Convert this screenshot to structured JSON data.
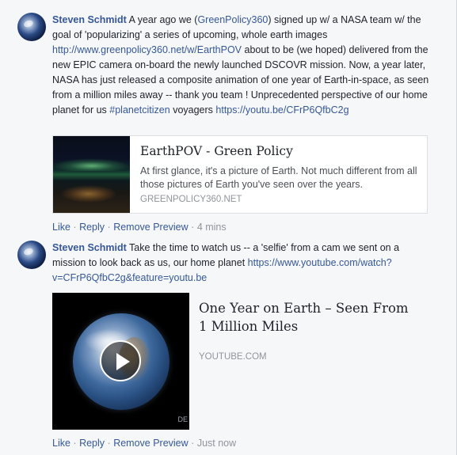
{
  "comments": [
    {
      "author": "Steven Schmidt",
      "body_parts": [
        "A year ago we (",
        "GreenPolicy360",
        ") signed up w/ a NASA team w/ the goal of 'popularizing' a series of upcoming, whole earth images ",
        "http://www.greenpolicy360.net/w/EarthPOV",
        " about to be (we hoped) delivered from the new EPIC camera on-board the newly launched DSCOVR mission. Now, a year later, NASA has just released a composite animation of one year of Earth-in-space, as seen from a million miles away -- thank you team ! Unprecedented perspective of our home planet for us ",
        "#planetcitizen",
        " voyagers ",
        "https://youtu.be/CFrP6QfbC2g"
      ],
      "preview": {
        "title": "EarthPOV - Green Policy",
        "description": "At first glance, it's a picture of Earth. Not much different from all those pictures of Earth you've seen over the years.",
        "domain": "GREENPOLICY360.NET"
      },
      "actions": {
        "like": "Like",
        "reply": "Reply",
        "remove_preview": "Remove Preview",
        "time": "4 mins"
      }
    },
    {
      "author": "Steven Schmidt",
      "body_parts": [
        "Take the time to watch us -- a 'selfie' from a cam we sent on a mission to look back as us, our home planet ",
        "https://www.youtube.com/watch?v=CFrP6QfbC2g&feature=youtu.be"
      ],
      "preview": {
        "title": "One Year on Earth – Seen From 1 Million Miles",
        "domain": "YOUTUBE.COM",
        "corner_text": "DE"
      },
      "actions": {
        "like": "Like",
        "reply": "Reply",
        "remove_preview": "Remove Preview",
        "time": "Just now"
      }
    }
  ],
  "separator": "·",
  "colors": {
    "link": "#365899",
    "muted": "#90949c",
    "background": "#f6f7f9"
  },
  "icons": {
    "avatar": "earth-avatar-icon",
    "play": "play-icon"
  }
}
